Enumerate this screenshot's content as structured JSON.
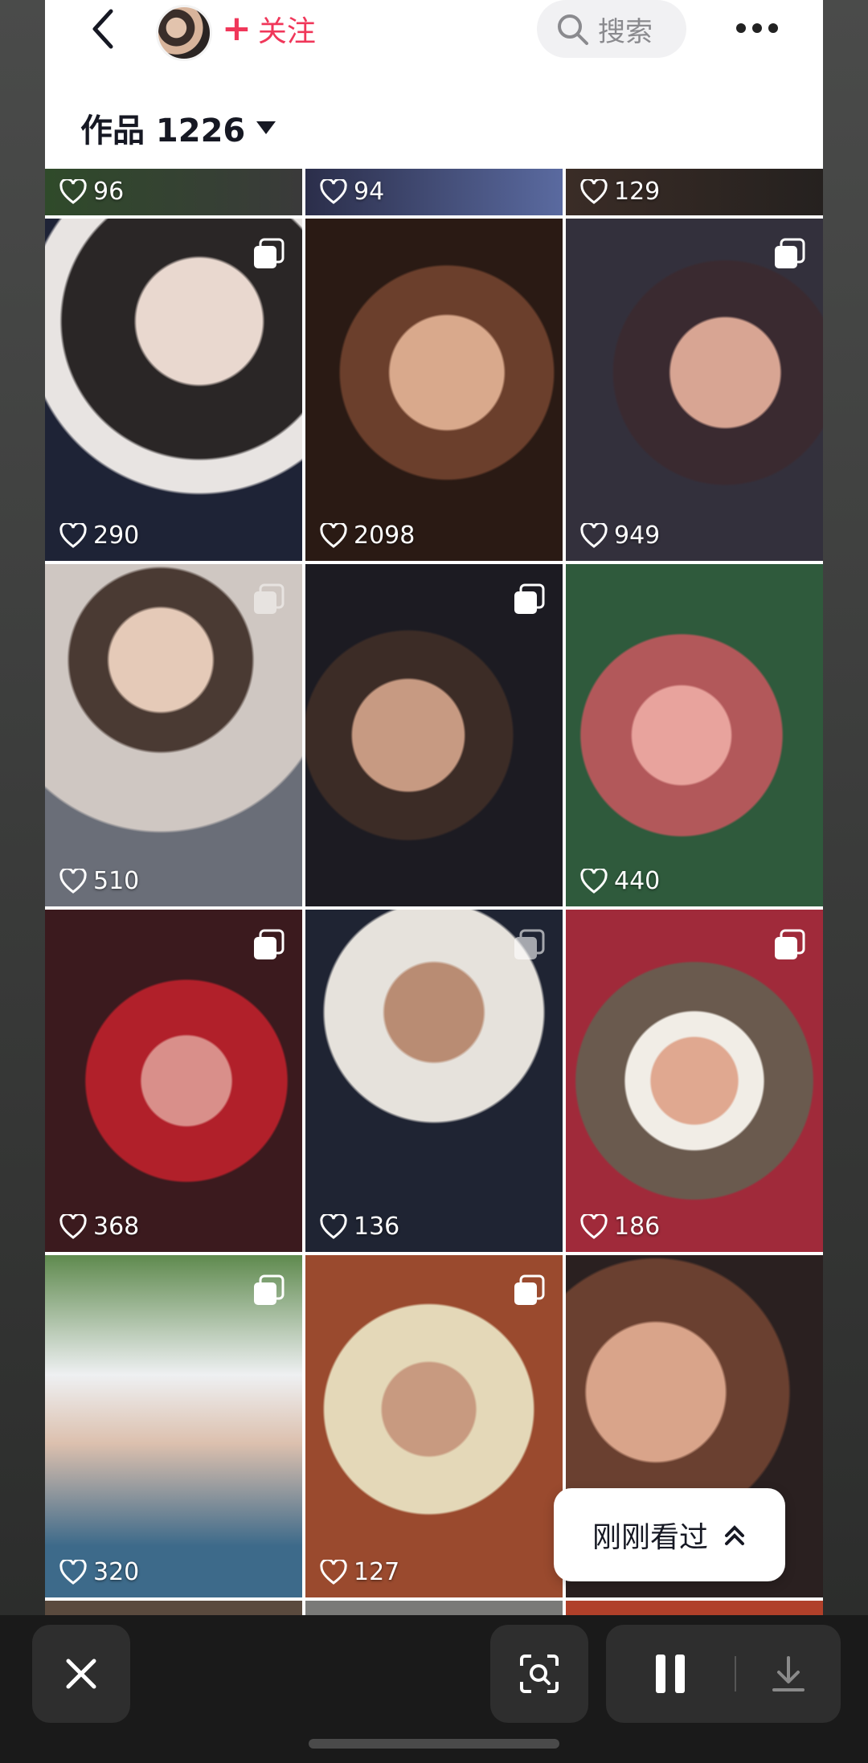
{
  "header": {
    "follow_label": "关注",
    "search_placeholder": "搜索",
    "works_label": "作品 1226"
  },
  "tiles": [
    {
      "likes": "96"
    },
    {
      "likes": "94"
    },
    {
      "likes": "129"
    },
    {
      "likes": "290"
    },
    {
      "likes": "2098"
    },
    {
      "likes": "949"
    },
    {
      "likes": "510"
    },
    {
      "likes": ""
    },
    {
      "likes": "440"
    },
    {
      "likes": "368"
    },
    {
      "likes": "136"
    },
    {
      "likes": "186"
    },
    {
      "likes": "320"
    },
    {
      "likes": "127"
    },
    {
      "likes": ""
    }
  ],
  "recent": {
    "label": "刚刚看过"
  },
  "colors": {
    "accent": "#f0375a",
    "bottom_bar": "#1a1a1a"
  },
  "icons": [
    "back-icon",
    "search-icon",
    "more-icon",
    "heart-icon",
    "multi-image-icon",
    "chevron-up-icon",
    "close-icon",
    "scan-icon",
    "pause-icon",
    "download-icon"
  ]
}
